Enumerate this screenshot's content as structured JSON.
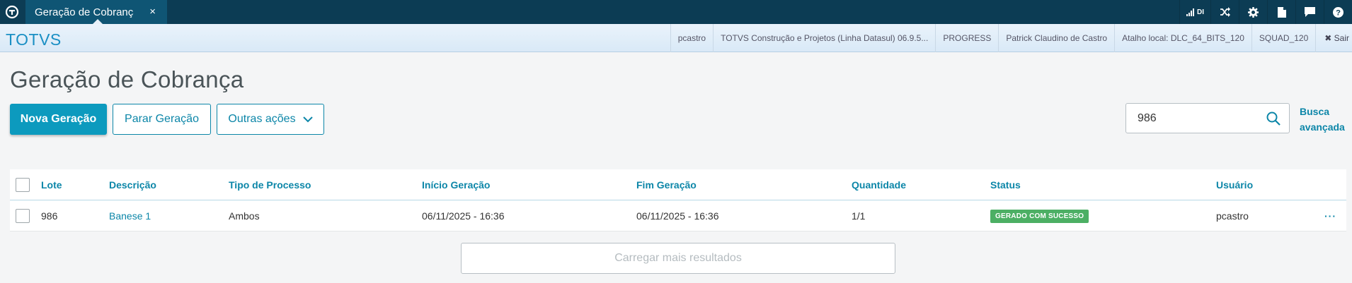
{
  "topbar": {
    "tab_title": "Geração de Cobrança",
    "tab_close": "×",
    "di_label": "DI",
    "icons": [
      "signal-icon",
      "shuffle-icon",
      "gear-icon",
      "document-icon",
      "chat-icon",
      "help-icon"
    ]
  },
  "brandbar": {
    "brand": "TOTVS",
    "context": [
      "pcastro",
      "TOTVS Construção e Projetos (Linha Datasul) 06.9.5...",
      "PROGRESS",
      "Patrick Claudino de Castro",
      "Atalho local: DLC_64_BITS_120",
      "SQUAD_120"
    ],
    "logout": "✖ Sair"
  },
  "page": {
    "title": "Geração de Cobrança",
    "new_button": "Nova Geração",
    "stop_button": "Parar Geração",
    "other_actions": "Outras ações",
    "search_value": "986",
    "advanced_search_line1": "Busca",
    "advanced_search_line2": "avançada"
  },
  "table": {
    "columns": [
      "Lote",
      "Descrição",
      "Tipo de Processo",
      "Início Geração",
      "Fim Geração",
      "Quantidade",
      "Status",
      "Usuário"
    ],
    "rows": [
      {
        "lote": "986",
        "descricao": "Banese 1",
        "tipo": "Ambos",
        "inicio": "06/11/2025 - 16:36",
        "fim": "06/11/2025 - 16:36",
        "quantidade": "1/1",
        "status": "GERADO COM SUCESSO",
        "usuario": "pcastro",
        "actions": "···"
      }
    ],
    "load_more": "Carregar mais resultados"
  },
  "colors": {
    "topbar": "#0c3c54",
    "accent": "#0c9abe",
    "link": "#0c86a8",
    "success": "#4caf64"
  }
}
